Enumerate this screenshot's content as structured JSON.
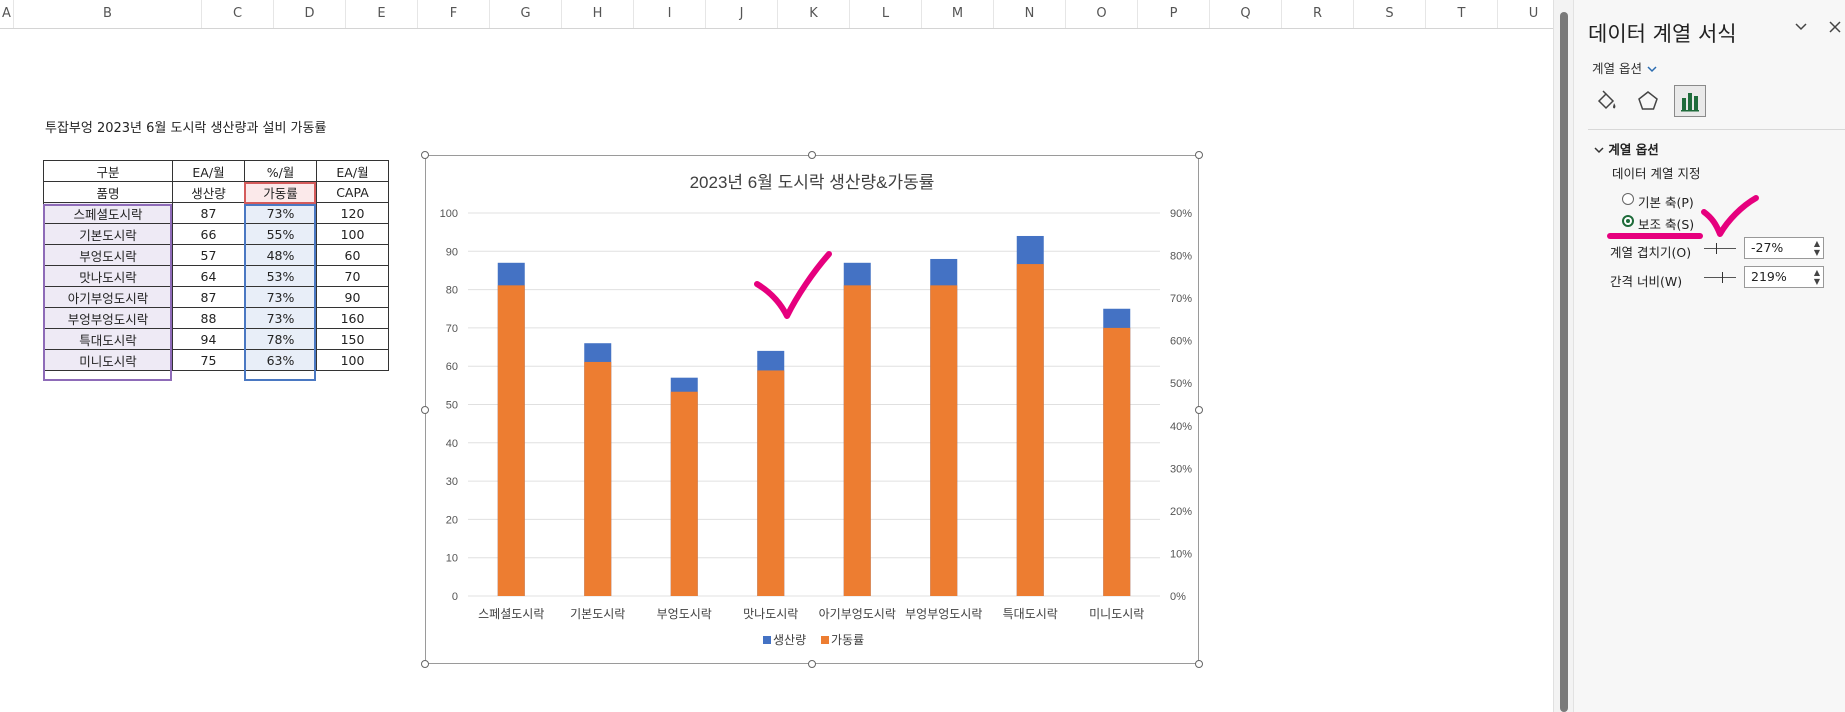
{
  "columns": [
    "A",
    "B",
    "C",
    "D",
    "E",
    "F",
    "G",
    "H",
    "I",
    "J",
    "K",
    "L",
    "M",
    "N",
    "O",
    "P",
    "Q",
    "R",
    "S",
    "T",
    "U"
  ],
  "sheet_title": "투잡부엉 2023년 6월 도시락 생산량과 설비 가동률",
  "table": {
    "header1": [
      "구분",
      "EA/월",
      "%/월",
      "EA/월"
    ],
    "header2": [
      "품명",
      "생산량",
      "가동률",
      "CAPA"
    ],
    "rows": [
      [
        "스페셜도시락",
        "87",
        "73%",
        "120"
      ],
      [
        "기본도시락",
        "66",
        "55%",
        "100"
      ],
      [
        "부엉도시락",
        "57",
        "48%",
        "60"
      ],
      [
        "맛나도시락",
        "64",
        "53%",
        "70"
      ],
      [
        "아기부엉도시락",
        "87",
        "73%",
        "90"
      ],
      [
        "부엉부엉도시락",
        "88",
        "73%",
        "160"
      ],
      [
        "특대도시락",
        "94",
        "78%",
        "150"
      ],
      [
        "미니도시락",
        "75",
        "63%",
        "100"
      ]
    ]
  },
  "chart_data": {
    "type": "bar",
    "title": "2023년 6월 도시락 생산량&가동률",
    "categories": [
      "스페셜도시락",
      "기본도시락",
      "부엉도시락",
      "맛나도시락",
      "아기부엉도시락",
      "부엉부엉도시락",
      "특대도시락",
      "미니도시락"
    ],
    "series": [
      {
        "name": "생산량",
        "axis": "primary",
        "color": "#4472c4",
        "values": [
          87,
          66,
          57,
          64,
          87,
          88,
          94,
          75
        ]
      },
      {
        "name": "가동률",
        "axis": "secondary",
        "color": "#ed7d31",
        "values": [
          0.73,
          0.55,
          0.48,
          0.53,
          0.73,
          0.73,
          0.78,
          0.63
        ]
      }
    ],
    "y_primary": {
      "min": 0,
      "max": 100,
      "ticks": [
        "0",
        "10",
        "20",
        "30",
        "40",
        "50",
        "60",
        "70",
        "80",
        "90",
        "100"
      ]
    },
    "y_secondary": {
      "min": 0,
      "max": 0.9,
      "ticks": [
        "0%",
        "10%",
        "20%",
        "30%",
        "40%",
        "50%",
        "60%",
        "70%",
        "80%",
        "90%"
      ]
    },
    "legend_position": "bottom",
    "grid": true,
    "series_overlap": "-27%",
    "gap_width": "219%"
  },
  "pane": {
    "title": "데이터 계열 서식",
    "subtitle": "계열 옵션",
    "section": "계열 옵션",
    "assign_label": "데이터 계열 지정",
    "radio_primary": "기본 축(P)",
    "radio_secondary": "보조 축(S)",
    "selected_axis": "secondary",
    "overlap_label": "계열 겹치기(O)",
    "overlap_value": "-27%",
    "gap_label": "간격 너비(W)",
    "gap_value": "219%",
    "icons": [
      "paint-bucket-icon",
      "pentagon-icon",
      "bar-chart-icon"
    ]
  },
  "colors": {
    "primary_series": "#4472c4",
    "secondary_series": "#ed7d31",
    "annotation": "#e6007e",
    "selected_radio": "#1e6b3a"
  }
}
